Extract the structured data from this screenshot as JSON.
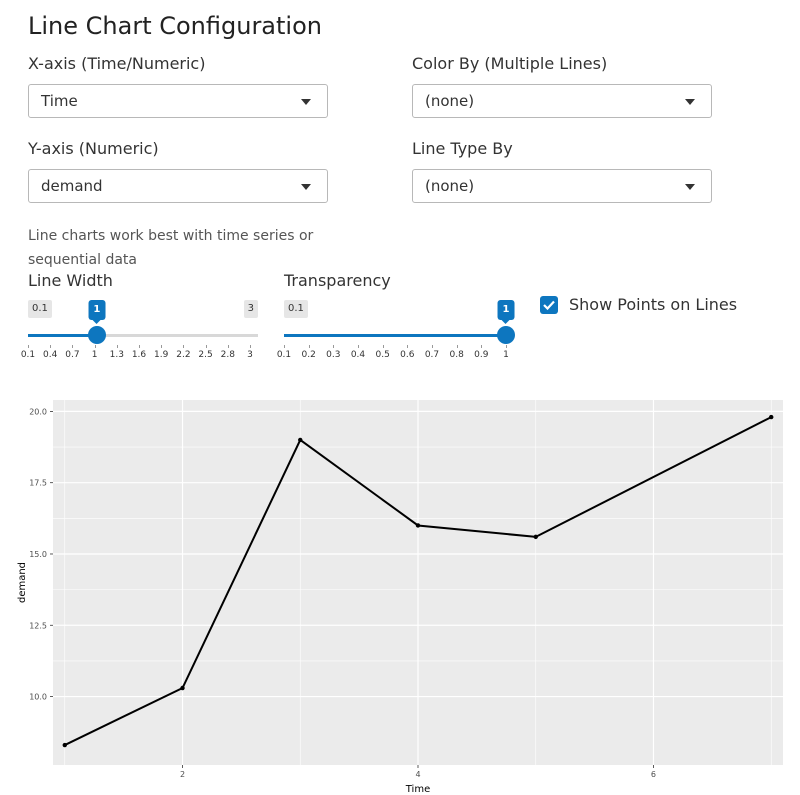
{
  "page": {
    "title": "Line Chart Configuration"
  },
  "controls": {
    "x_axis": {
      "label": "X-axis (Time/Numeric)",
      "value": "Time"
    },
    "color_by": {
      "label": "Color By (Multiple Lines)",
      "value": "(none)"
    },
    "y_axis": {
      "label": "Y-axis (Numeric)",
      "value": "demand"
    },
    "line_type_by": {
      "label": "Line Type By",
      "value": "(none)"
    },
    "help_text": "Line charts work best with time series or sequential data",
    "line_width": {
      "label": "Line Width",
      "min": 0.1,
      "max": 3,
      "value": 1,
      "min_label": "0.1",
      "max_label": "3",
      "value_label": "1",
      "ticks": [
        "0.1",
        "0.4",
        "0.7",
        "1",
        "1.3",
        "1.6",
        "1.9",
        "2.2",
        "2.5",
        "2.8",
        "3"
      ]
    },
    "transparency": {
      "label": "Transparency",
      "min": 0.1,
      "max": 1,
      "value": 1,
      "min_label": "0.1",
      "value_label": "1",
      "ticks": [
        "0.1",
        "0.2",
        "0.3",
        "0.4",
        "0.5",
        "0.6",
        "0.7",
        "0.8",
        "0.9",
        "1"
      ]
    },
    "show_points": {
      "label": "Show Points on Lines",
      "checked": true
    }
  },
  "chart_data": {
    "type": "line",
    "xlabel": "Time",
    "ylabel": "demand",
    "x": [
      1,
      2,
      3,
      4,
      5,
      7
    ],
    "y": [
      8.3,
      10.3,
      19.0,
      16.0,
      15.6,
      19.8
    ],
    "xlim": [
      0.9,
      7.1
    ],
    "ylim": [
      7.6,
      20.4
    ],
    "x_ticks": [
      2,
      4,
      6
    ],
    "x_tick_labels": [
      "2",
      "4",
      "6"
    ],
    "y_ticks": [
      10.0,
      12.5,
      15.0,
      17.5,
      20.0
    ],
    "y_tick_labels": [
      "10.0",
      "12.5",
      "15.0",
      "17.5",
      "20.0"
    ],
    "grid": true,
    "show_points": true,
    "colors": {
      "line": "#000000",
      "panel": "#ebebeb",
      "grid": "#ffffff"
    }
  }
}
